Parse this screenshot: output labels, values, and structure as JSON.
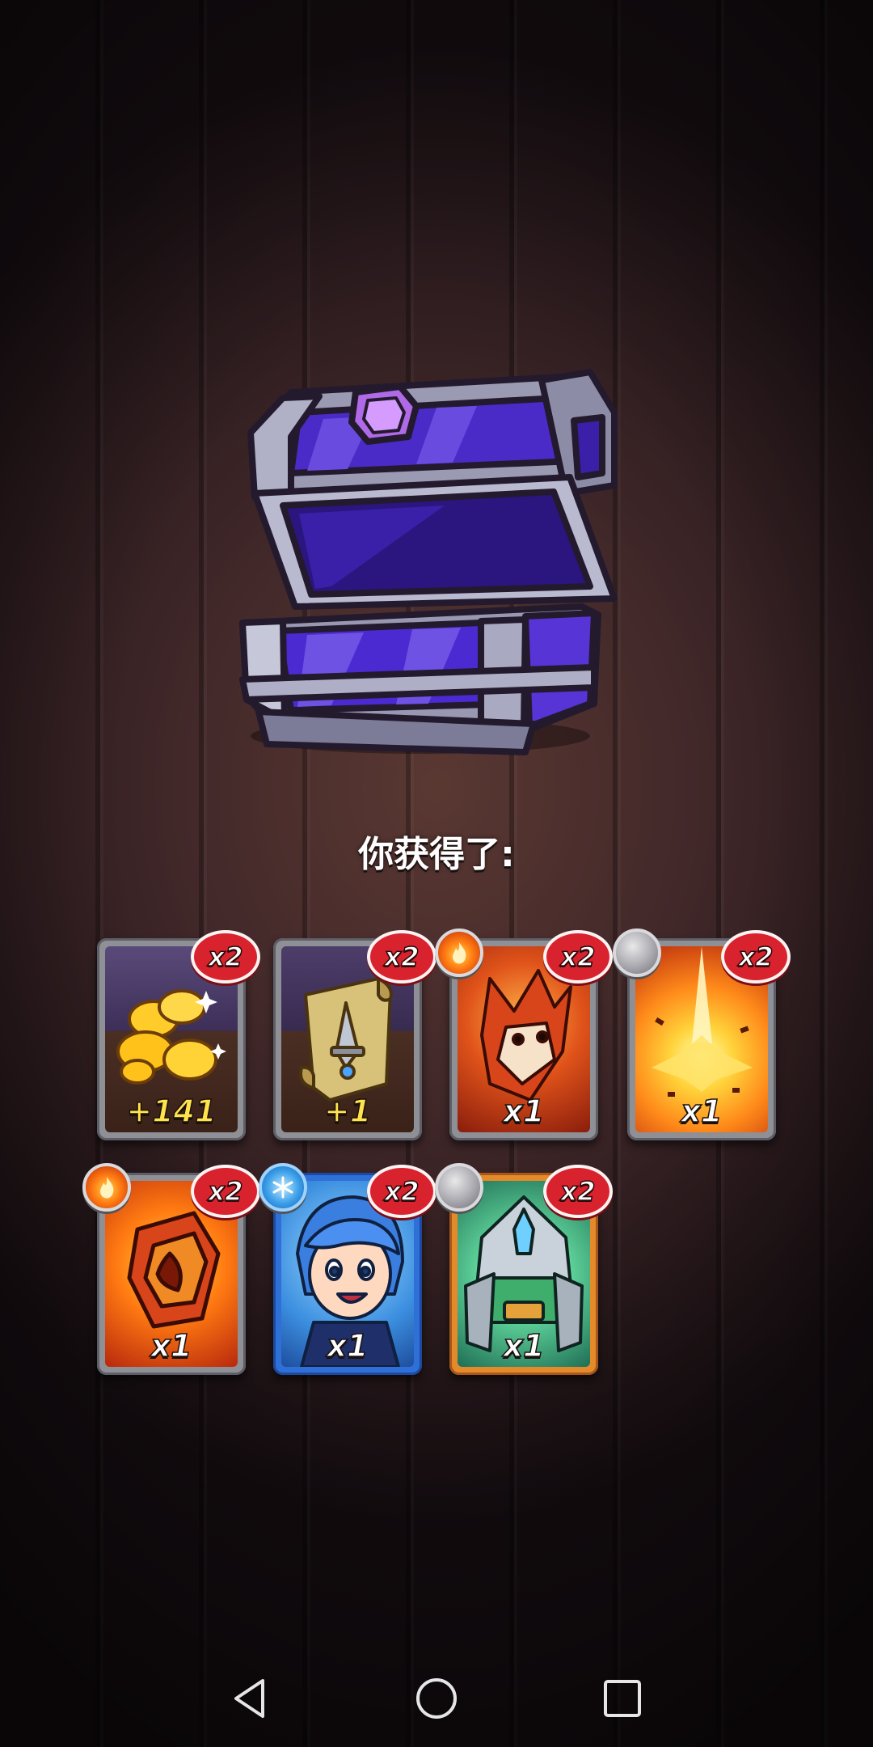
{
  "reward_screen": {
    "title": "你获得了:"
  },
  "cards": [
    {
      "name": "gold-coins-card",
      "count_badge": "x2",
      "amount": "+141",
      "amount_color": "yellow",
      "element": null,
      "frame": "gray"
    },
    {
      "name": "scroll-card",
      "count_badge": "x2",
      "amount": "+1",
      "amount_color": "yellow",
      "element": null,
      "frame": "gray"
    },
    {
      "name": "fire-fox-hero-card",
      "count_badge": "x2",
      "amount": "x1",
      "amount_color": "white",
      "element": "fire",
      "frame": "gray"
    },
    {
      "name": "explosion-spell-card",
      "count_badge": "x2",
      "amount": "x1",
      "amount_color": "white",
      "element": "stone",
      "frame": "gray"
    },
    {
      "name": "fire-shield-card",
      "count_badge": "x2",
      "amount": "x1",
      "amount_color": "white",
      "element": "fire",
      "frame": "gray"
    },
    {
      "name": "ice-girl-hero-card",
      "count_badge": "x2",
      "amount": "x1",
      "amount_color": "white",
      "element": "ice",
      "frame": "blue"
    },
    {
      "name": "knight-hero-card",
      "count_badge": "x2",
      "amount": "x1",
      "amount_color": "white",
      "element": "stone",
      "frame": "orange"
    }
  ],
  "colors": {
    "badge_red": "#d8232e",
    "chest_purple": "#4b2ad1",
    "frame_gray": "#8f8f96",
    "frame_blue": "#2f6fd8",
    "frame_orange": "#e58a2a"
  },
  "nav": {
    "back_icon": "back-triangle-icon",
    "home_icon": "home-circle-icon",
    "recents_icon": "recents-square-icon"
  }
}
